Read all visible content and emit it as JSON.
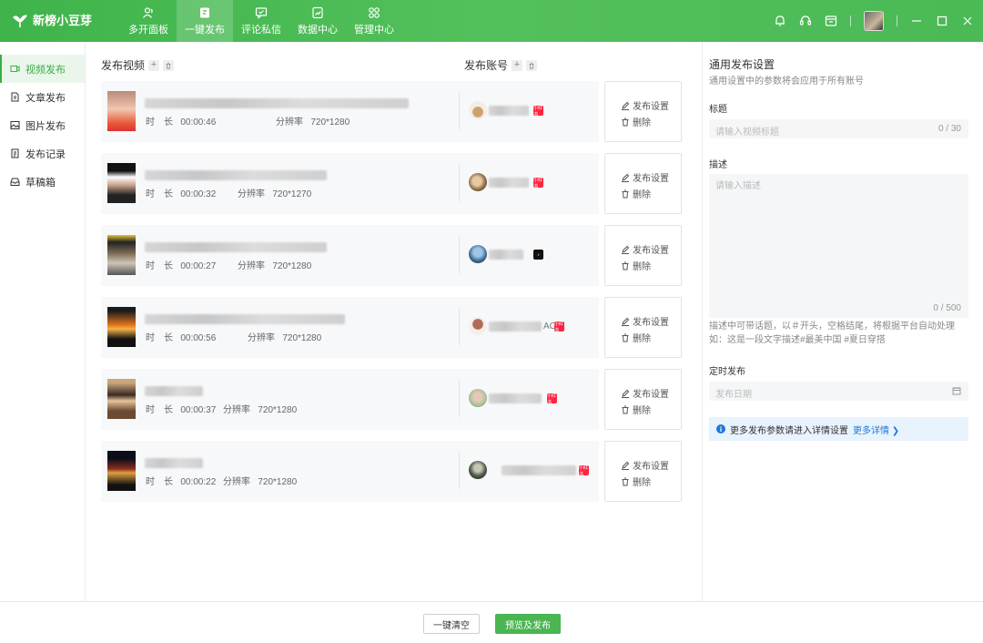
{
  "app": {
    "name": "新榜小豆芽"
  },
  "nav": [
    {
      "label": "多开面板",
      "icon": "users-icon"
    },
    {
      "label": "一键发布",
      "icon": "publish-icon",
      "active": true
    },
    {
      "label": "评论私信",
      "icon": "comment-icon"
    },
    {
      "label": "数据中心",
      "icon": "data-icon"
    },
    {
      "label": "管理中心",
      "icon": "grid-icon"
    }
  ],
  "sidebar": [
    {
      "label": "视频发布",
      "icon": "video-icon",
      "active": true
    },
    {
      "label": "文章发布",
      "icon": "document-icon"
    },
    {
      "label": "图片发布",
      "icon": "image-icon"
    },
    {
      "label": "发布记录",
      "icon": "record-icon"
    },
    {
      "label": "草稿箱",
      "icon": "drafts-icon"
    }
  ],
  "main": {
    "video_header": "发布视频",
    "account_header": "发布账号",
    "duration_label": "时　长",
    "resolution_label": "分辨率",
    "settings_label": "发布设置",
    "delete_label": "删除",
    "items": [
      {
        "duration": "00:00:46",
        "resolution": "720*1280",
        "platform": "xhs",
        "account_suffix": ""
      },
      {
        "duration": "00:00:32",
        "resolution": "720*1270",
        "platform": "xhs",
        "account_suffix": ""
      },
      {
        "duration": "00:00:27",
        "resolution": "720*1280",
        "platform": "douyin",
        "account_suffix": ""
      },
      {
        "duration": "00:00:56",
        "resolution": "720*1280",
        "platform": "xhs",
        "account_suffix": "AC"
      },
      {
        "duration": "00:00:37",
        "resolution": "720*1280",
        "platform": "xhs",
        "account_suffix": ""
      },
      {
        "duration": "00:00:22",
        "resolution": "720*1280",
        "platform": "xhs",
        "account_suffix": ""
      }
    ]
  },
  "settings": {
    "title": "通用发布设置",
    "subtitle": "通用设置中的参数将会应用于所有账号",
    "title_label": "标题",
    "title_placeholder": "请输入视频标题",
    "title_count": "0 / 30",
    "desc_label": "描述",
    "desc_placeholder": "请输入描述",
    "desc_count": "0 / 500",
    "hint_line1": "描述中可带话题，以＃开头，空格结尾，将根据平台自动处理",
    "hint_line2": "如：这是一段文字描述#最美中国 #夏日穿搭",
    "schedule_label": "定时发布",
    "schedule_placeholder": "发布日期",
    "info_text": "更多发布参数请进入详情设置",
    "info_link": "更多详情"
  },
  "footer": {
    "clear_label": "一键清空",
    "publish_label": "预览及发布"
  }
}
